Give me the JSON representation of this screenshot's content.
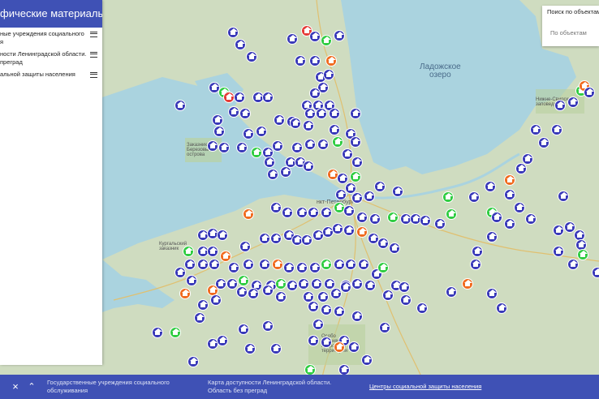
{
  "colors": {
    "water": "#aad3df",
    "land": "#cfdcc0",
    "accent": "#3f51b5",
    "marker_blue": "#3838b8",
    "marker_green": "#2ecc40",
    "marker_orange": "#f06a1e"
  },
  "panel": {
    "title": "фические материалы",
    "layers": [
      {
        "line1": "ные учреждения социального",
        "line2": "я"
      },
      {
        "line1": "ности Ленинградской области.",
        "line2": "преград"
      },
      {
        "line1": "альной защиты населения",
        "line2": ""
      }
    ]
  },
  "search": {
    "label": "Поиск по объектам",
    "placeholder": "По объектам"
  },
  "map": {
    "labels": {
      "lake_line1": "Ладожское",
      "lake_line2": "озеро",
      "spb": "нкт-Петербург",
      "berezovye": "Заказник Березовые острова",
      "kurgalsky": "Кургальский заказник",
      "nizhne": "Нижне-Свирский заповедник",
      "special": "Особо охраняемая природная территория"
    }
  },
  "footer": {
    "close_icon": "×",
    "expand_icon": "⌃",
    "tabs": [
      {
        "line1": "Государственные учреждения социального",
        "line2": "обслуживания"
      },
      {
        "line1": "Карта доступности Ленинградской области.",
        "line2": "Область без преград"
      },
      {
        "line1": "Центры социальной защиты населения",
        "line2": ""
      }
    ]
  }
}
